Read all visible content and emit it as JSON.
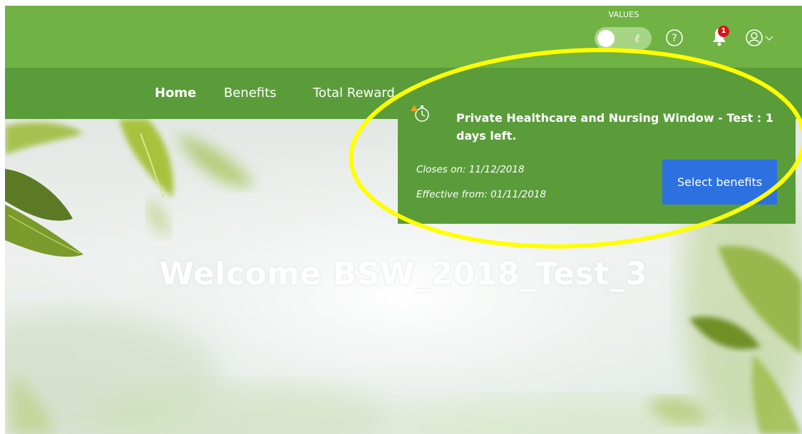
{
  "header": {
    "values_label": "VALUES",
    "values_toggle_icon": "leaf-pen-icon",
    "help_icon": "question-circle-icon",
    "notification_icon": "bell-icon",
    "notification_count": "1",
    "user_icon": "user-circle-icon",
    "user_menu_icon": "chevron-down-icon"
  },
  "nav": {
    "items": [
      {
        "label": "Home",
        "active": true
      },
      {
        "label": "Benefits",
        "active": false
      },
      {
        "label": "Total Reward",
        "active": false
      }
    ]
  },
  "notification": {
    "icon": "stopwatch-warning-icon",
    "title": "Private Healthcare and Nursing Window - Test : 1 days left.",
    "closes": "Closes on: 11/12/2018",
    "effective": "Effective from: 01/11/2018",
    "button_label": "Select benefits"
  },
  "hero": {
    "welcome": "Welcome BSW_2018_Test_3"
  },
  "colors": {
    "topbar": "#70b243",
    "navbar": "#5a9c3a",
    "notification_bg": "#5a9c3a",
    "button": "#2c71df",
    "badge": "#d7141a",
    "highlight": "#ffff00"
  }
}
